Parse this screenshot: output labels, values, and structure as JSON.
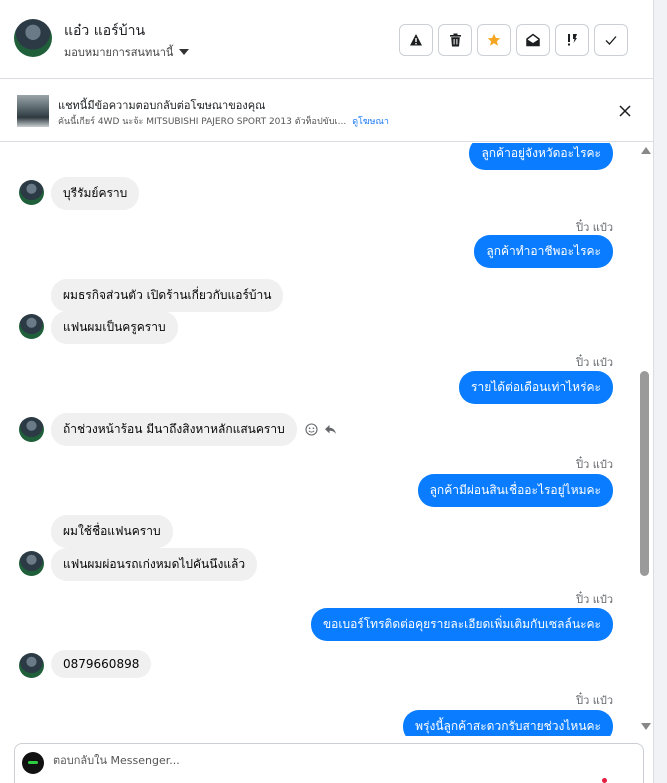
{
  "header": {
    "contact_name": "แอ๋ว แอร์บ้าน",
    "assign_label": "มอบหมายการสนทนานี้",
    "actions": [
      {
        "icon": "warning-icon"
      },
      {
        "icon": "trash-icon"
      },
      {
        "icon": "star-icon",
        "color": "#f5a623"
      },
      {
        "icon": "mail-open-icon"
      },
      {
        "icon": "follow-up-icon"
      },
      {
        "icon": "check-icon"
      }
    ]
  },
  "ad_banner": {
    "title": "แชทนี้มีข้อความตอบกลับต่อโฆษณาของคุณ",
    "description": "คันนี้เกียร์ 4WD นะจ้ะ MITSUBISHI PAJERO SPORT 2013 ตัวท็อปขับเ...",
    "link": "ดูโฆษณา"
  },
  "messages": {
    "partial_top": "ลูกค้าอยู่จังหวัดอะไรคะ",
    "in_1": "บุรีรัมย์คราบ",
    "sender_1": "ปิ๋ว แป๋ว",
    "out_1": "ลูกค้าทำอาชีพอะไรคะ",
    "in_2a": "ผมธรกิจส่วนตัว เปิดร้านเกี่ยวกับแอร์บ้าน",
    "in_2b": "แฟนผมเป็นครูคราบ",
    "sender_2": "ปิ๋ว แป๋ว",
    "out_2": "รายได้ต่อเดือนเท่าไหร่คะ",
    "in_3": "ถ้าช่วงหน้าร้อน มีนาถึงสิงหาหลักแสนคราบ",
    "sender_3": "ปิ๋ว แป๋ว",
    "out_3": "ลูกค้ามีผ่อนสินเชื่ออะไรอยู่ไหมคะ",
    "in_4a": "ผมใช้ชื่อแฟนคราบ",
    "in_4b": "แฟนผมผ่อนรถเก่งหมดไปคันนึงแล้ว",
    "sender_4": "ปิ๋ว แป๋ว",
    "out_4": "ขอเบอร์โทรติดต่อคุยรายละเอียดเพิ่มเติมกับเซลล์นะคะ",
    "in_5": "0879660898",
    "sender_5": "ปิ๋ว แป๋ว",
    "out_5": "พรุ่งนี้ลูกค้าสะดวกรับสายช่วงไหนคะ"
  },
  "composer": {
    "placeholder": "ตอบกลับใน Messenger..."
  },
  "colors": {
    "outgoing_bubble": "#0a7cff",
    "incoming_bubble": "#f0f0f0"
  }
}
